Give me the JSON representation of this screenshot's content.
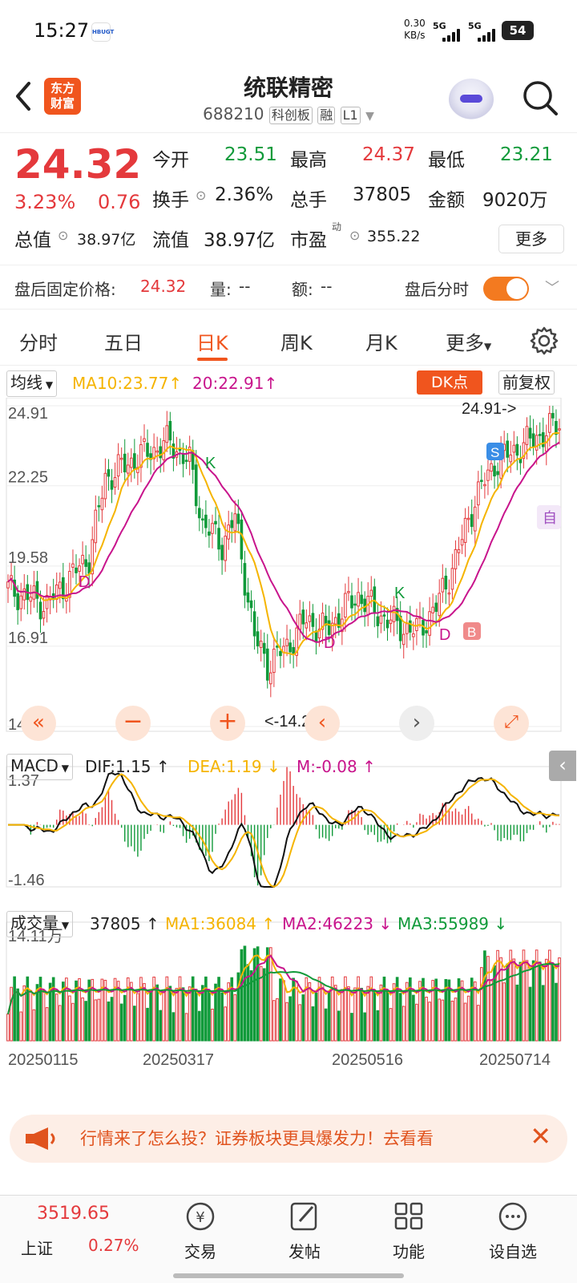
{
  "status_bar": {
    "time": "15:27",
    "notif_badge": "HBUGT",
    "net_speed_value": "0.30",
    "net_speed_unit": "KB/s",
    "sim1": "5G",
    "sim2": "5G",
    "battery": "54"
  },
  "header": {
    "back_icon": "chevron-left-icon",
    "logo_line1": "东方",
    "logo_line2": "财富",
    "title": "统联精密",
    "code": "688210",
    "tag1": "科创板",
    "tag2": "融",
    "tag3": "L1"
  },
  "quote": {
    "price": "24.32",
    "pct": "3.23%",
    "change": "0.76",
    "open_label": "今开",
    "open": "23.51",
    "high_label": "最高",
    "high": "24.37",
    "low_label": "最低",
    "low": "23.21",
    "turnover_label": "换手",
    "turnover": "2.36%",
    "volume_label": "总手",
    "volume": "37805",
    "amount_label": "金额",
    "amount": "9020万",
    "mktcap_label": "总值",
    "mktcap": "38.97亿",
    "float_label": "流值",
    "float_cap": "38.97亿",
    "pe_label": "市盈",
    "pe_sup": "动",
    "pe": "355.22",
    "more": "更多"
  },
  "after_hours": {
    "label": "盘后固定价格:",
    "price": "24.32",
    "vol_label": "量:",
    "vol": "--",
    "amt_label": "额:",
    "amt": "--",
    "switch_label": "盘后分时",
    "switch_on": true
  },
  "tabs": [
    "分时",
    "五日",
    "日K",
    "周K",
    "月K",
    "更多"
  ],
  "active_tab": "日K",
  "kline_toolbar": {
    "ma_select": "均线",
    "ma10": "MA10:23.77",
    "ma20": "20:22.91",
    "dk": "DK点",
    "adjust": "前复权"
  },
  "chart_data": {
    "type": "candlestick",
    "price_axis": [
      "24.91",
      "22.25",
      "19.58",
      "16.91",
      "14.24"
    ],
    "max_label": "24.91->",
    "min_label": "<-14.24",
    "markers": [
      "K",
      "D",
      "D",
      "K",
      "D",
      "S",
      "B",
      "自"
    ],
    "macd": {
      "select": "MACD",
      "dif": "DIF:1.15",
      "dea": "DEA:1.19",
      "m": "M:-0.08",
      "axis_top": "1.37",
      "axis_bottom": "-1.46"
    },
    "volume": {
      "select": "成交量",
      "value": "37805",
      "ma1": "MA1:36084",
      "ma2": "MA2:46223",
      "ma3": "MA3:55989",
      "axis_top": "14.11万"
    },
    "dates": [
      "20250115",
      "20250317",
      "20250516",
      "20250714"
    ]
  },
  "colors": {
    "up": "#e4393c",
    "down": "#119a3a",
    "accent": "#f0551e",
    "ma10": "#f5b400",
    "ma20": "#c8148c"
  },
  "banner": {
    "text": "行情来了怎么投？证券板块更具爆发力！去看看",
    "close": "✕"
  },
  "bottom_nav": {
    "index_value": "3519.65",
    "index_name": "上证",
    "index_pct": "0.27%",
    "items": [
      "交易",
      "发帖",
      "功能",
      "设自选"
    ]
  }
}
